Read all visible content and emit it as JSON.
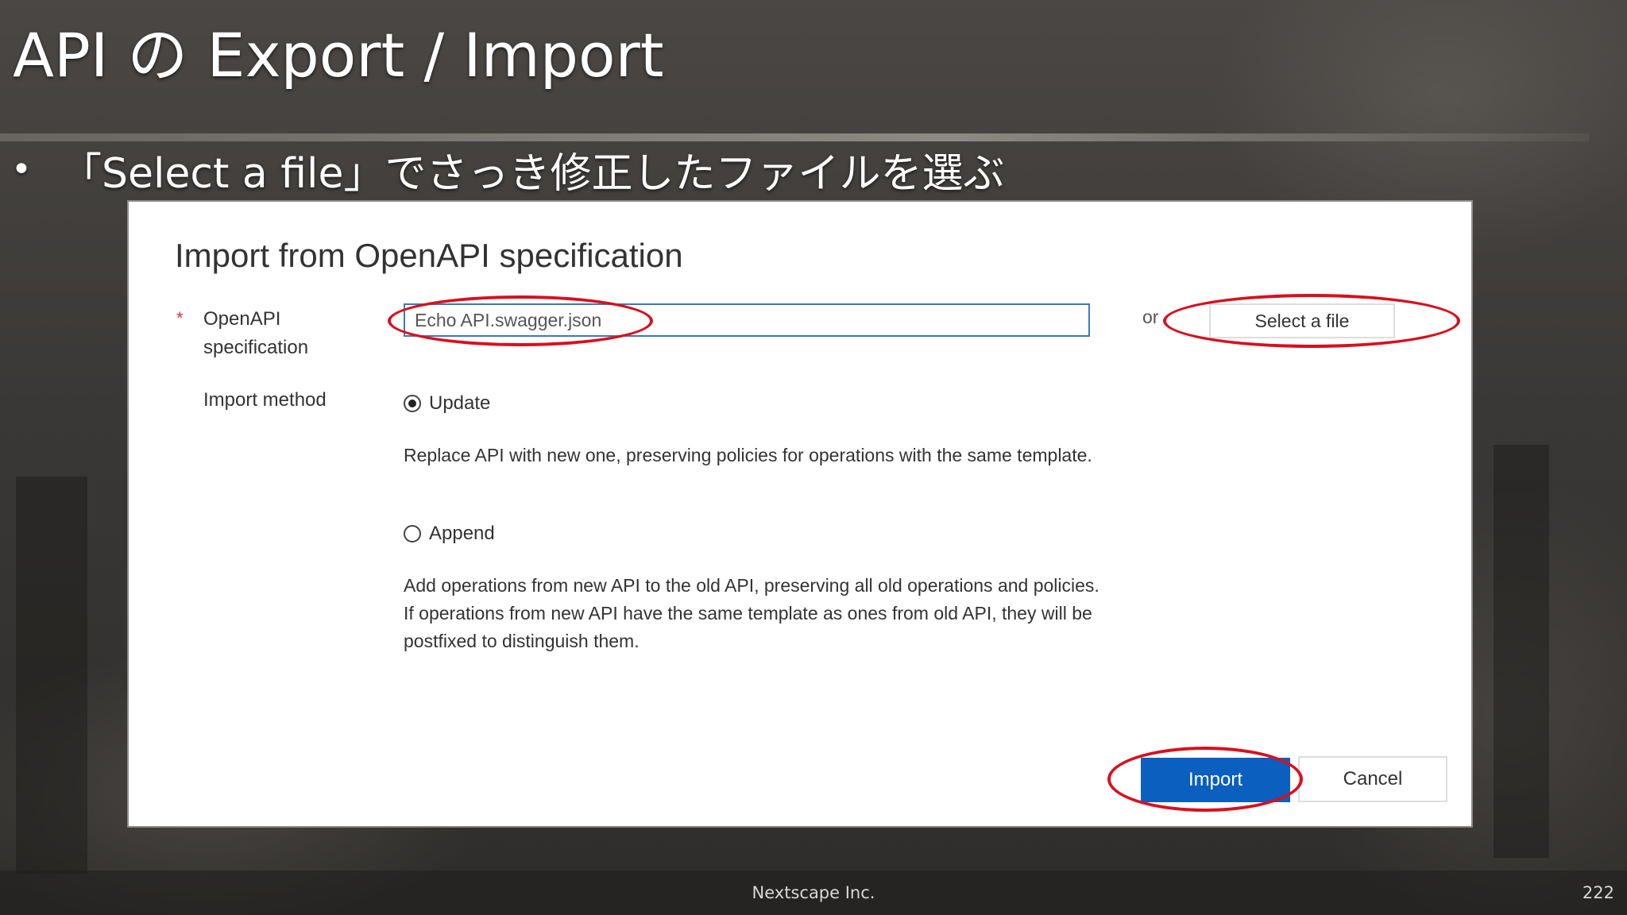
{
  "slide": {
    "title": "API の Export / Import",
    "bullet": "「Select a file」でさっき修正したファイルを選ぶ",
    "bullet_marker": "•",
    "footer_company": "Nextscape Inc.",
    "page_number": "222"
  },
  "dialog": {
    "title": "Import from OpenAPI specification",
    "required_marker": "*",
    "spec_label": "OpenAPI specification",
    "spec_value": "Echo API.swagger.json",
    "or_text": "or",
    "select_file_label": "Select a file",
    "method_label": "Import method",
    "options": [
      {
        "label": "Update",
        "checked": true,
        "description": "Replace API with new one, preserving policies for operations with the same template."
      },
      {
        "label": "Append",
        "checked": false,
        "description": "Add operations from new API to the old API, preserving all old operations and policies. If operations from new API have the same template as ones from old API, they will be postfixed to distinguish them."
      }
    ],
    "import_label": "Import",
    "cancel_label": "Cancel"
  },
  "colors": {
    "primary_button": "#0a5fbf",
    "highlight": "#d8101e",
    "input_border": "#3f78b5",
    "required": "#d13438"
  }
}
